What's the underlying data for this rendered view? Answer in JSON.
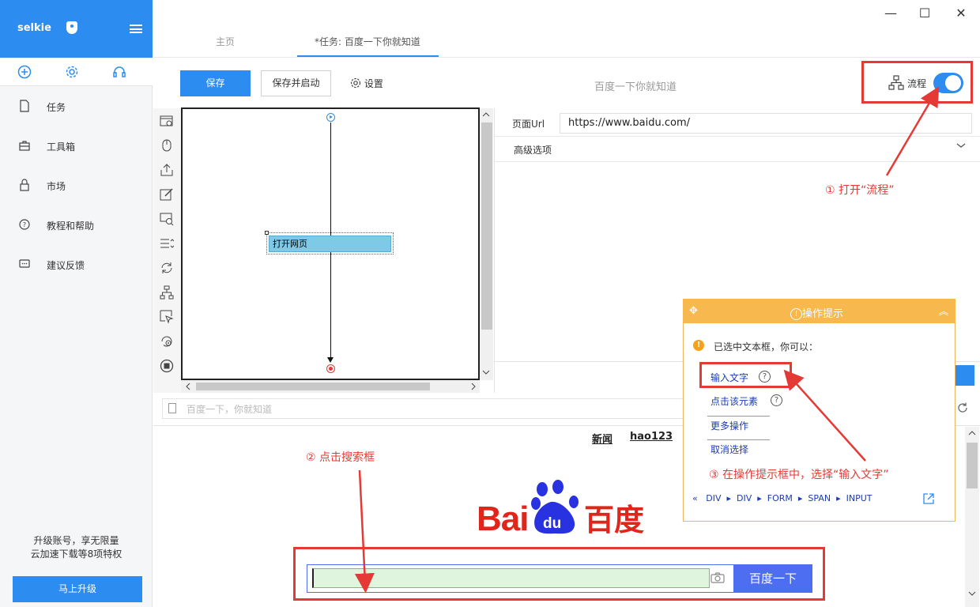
{
  "sidebar": {
    "logo": "selkie",
    "tools": [
      "add-icon",
      "gear-icon",
      "headset-icon"
    ],
    "items": [
      {
        "label": "任务",
        "icon": "document-icon"
      },
      {
        "label": "工具箱",
        "icon": "toolbox-icon"
      },
      {
        "label": "市场",
        "icon": "lock-icon"
      },
      {
        "label": "教程和帮助",
        "icon": "help-icon"
      },
      {
        "label": "建议反馈",
        "icon": "feedback-icon"
      }
    ],
    "promo_line1": "升级账号，享无限量",
    "promo_line2": "云加速下载等8项特权",
    "upgrade_label": "马上升级"
  },
  "window": {
    "minimize": "—",
    "maximize": "☐",
    "close": "✕"
  },
  "tabs": [
    {
      "label": "主页",
      "active": false
    },
    {
      "label": "*任务: 百度一下你就知道",
      "active": true
    }
  ],
  "toolbar": {
    "save_label": "保存",
    "save_run_label": "保存并启动",
    "settings_label": "设置",
    "title": "百度一下你就知道",
    "flow_label": "流程",
    "flow_enabled": true
  },
  "flow": {
    "node_label": "打开网页"
  },
  "form": {
    "url_label": "页面Url",
    "url_value": "https://www.baidu.com/",
    "advanced_label": "高级选项"
  },
  "browser": {
    "address": "百度一下，你就知道",
    "top_links": [
      "新闻",
      "hao123"
    ],
    "search_button": "百度一下"
  },
  "tips": {
    "title": "操作提示",
    "message": "已选中文本框，你可以：",
    "options": [
      "输入文字",
      "点击该元素",
      "更多操作",
      "取消选择"
    ],
    "path": [
      "DIV",
      "DIV",
      "FORM",
      "SPAN",
      "INPUT"
    ]
  },
  "annotations": {
    "step1": "① 打开“流程”",
    "step2": "② 点击搜索框",
    "step3": "③ 在操作提示框中，选择“输入文字”"
  },
  "colors": {
    "primary": "#2d8cf0",
    "annotation": "#e53935",
    "tips_header": "#f7b84e",
    "baidu_red": "#e1251b",
    "baidu_blue": "#2932e1"
  }
}
